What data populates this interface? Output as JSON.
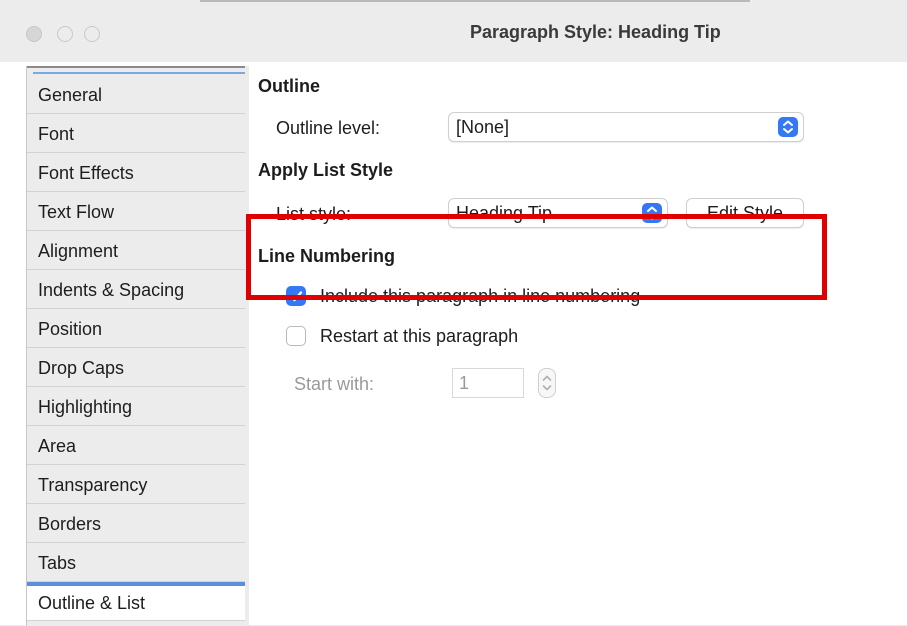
{
  "window": {
    "title": "Paragraph Style: Heading Tip"
  },
  "sidebar": {
    "items": [
      {
        "label": "General"
      },
      {
        "label": "Font"
      },
      {
        "label": "Font Effects"
      },
      {
        "label": "Text Flow"
      },
      {
        "label": "Alignment"
      },
      {
        "label": "Indents & Spacing"
      },
      {
        "label": "Position"
      },
      {
        "label": "Drop Caps"
      },
      {
        "label": "Highlighting"
      },
      {
        "label": "Area"
      },
      {
        "label": "Transparency"
      },
      {
        "label": "Borders"
      },
      {
        "label": "Tabs"
      },
      {
        "label": "Outline & List"
      }
    ],
    "selected": "Outline & List"
  },
  "outline": {
    "title": "Outline",
    "level_label": "Outline level:",
    "level_value": "[None]"
  },
  "list_style": {
    "title": "Apply List Style",
    "style_label": "List style:",
    "style_value": "Heading Tip",
    "edit_button": "Edit Style"
  },
  "line_numbering": {
    "title": "Line Numbering",
    "include_label": "Include this paragraph in line numbering",
    "include_checked": true,
    "restart_label": "Restart at this paragraph",
    "restart_checked": false,
    "start_with_label": "Start with:",
    "start_with_value": "1"
  },
  "colors": {
    "accent": "#3478f6",
    "highlight": "#e00000",
    "selected_tab_bar": "#5a8fdc"
  },
  "icons": {
    "select_arrows": "chevron-up-down-icon",
    "checkmark": "checkmark-icon",
    "spinner": "stepper-icon"
  }
}
